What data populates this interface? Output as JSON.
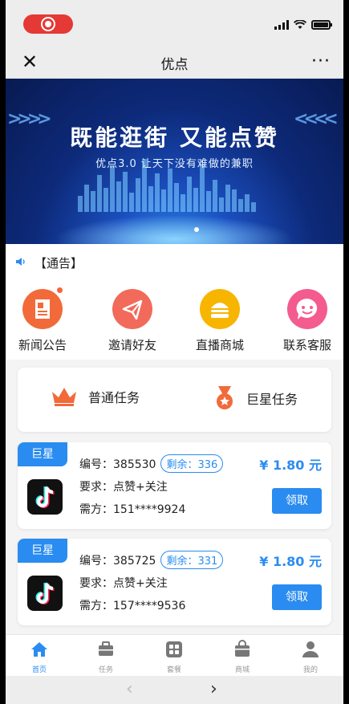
{
  "nav": {
    "title": "优点",
    "close": "✕",
    "more": "···"
  },
  "banner": {
    "headline": "既能逛街 又能点赞",
    "subline": "优点3.0 让天下没有难做的兼职"
  },
  "notice": {
    "text": "【通告】"
  },
  "quick_menu": [
    {
      "label": "新闻公告",
      "icon": "news-icon",
      "color": "#f26a3a"
    },
    {
      "label": "邀请好友",
      "icon": "paper-plane-icon",
      "color": "#f26a5a"
    },
    {
      "label": "直播商城",
      "icon": "burger-icon",
      "color": "#f7b500"
    },
    {
      "label": "联系客服",
      "icon": "smile-chat-icon",
      "color": "#f45b8f"
    }
  ],
  "task_tabs": [
    {
      "label": "普通任务",
      "icon": "crown-icon"
    },
    {
      "label": "巨星任务",
      "icon": "medal-icon"
    }
  ],
  "tasks": [
    {
      "tag": "巨星",
      "id_label": "编号：385530",
      "remain": "剩余：336",
      "require": "要求：点赞+关注",
      "requester": "需方：151****9924",
      "price": "¥ 1.80 元",
      "claim": "领取"
    },
    {
      "tag": "巨星",
      "id_label": "编号：385725",
      "remain": "剩余：331",
      "require": "要求：点赞+关注",
      "requester": "需方：157****9536",
      "price": "¥ 1.80 元",
      "claim": "领取"
    }
  ],
  "tabbar": [
    {
      "label": "首页",
      "icon": "home-icon",
      "active": true
    },
    {
      "label": "任务",
      "icon": "briefcase-icon",
      "active": false
    },
    {
      "label": "套餐",
      "icon": "grid-icon",
      "active": false
    },
    {
      "label": "商城",
      "icon": "shop-bag-icon",
      "active": false
    },
    {
      "label": "我的",
      "icon": "person-icon",
      "active": false
    }
  ],
  "browser": {
    "back": "‹",
    "forward": "›"
  },
  "colors": {
    "accent": "#2a8cf0",
    "nav_bg": "#ededed"
  }
}
